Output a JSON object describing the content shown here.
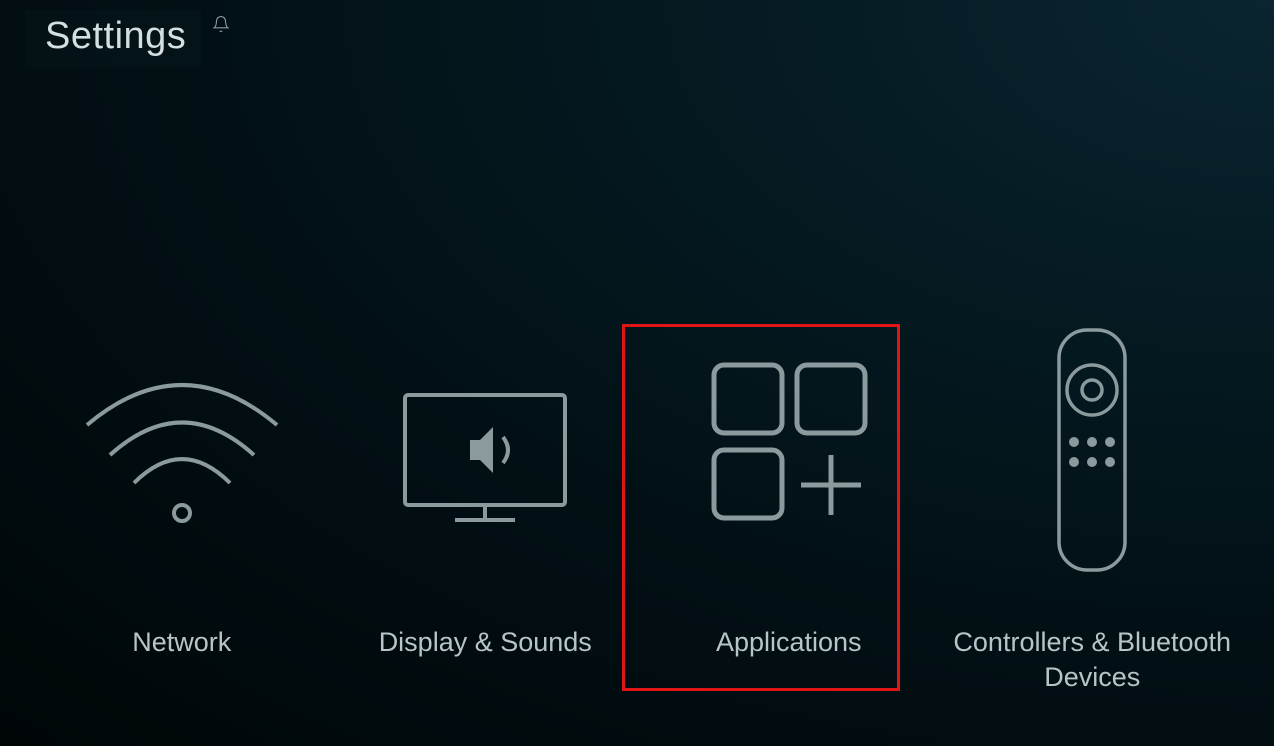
{
  "header": {
    "title": "Settings"
  },
  "tiles": [
    {
      "label": "Network",
      "icon": "wifi-icon"
    },
    {
      "label": "Display & Sounds",
      "icon": "display-sound-icon"
    },
    {
      "label": "Applications",
      "icon": "apps-icon",
      "highlighted": true
    },
    {
      "label": "Controllers & Bluetooth Devices",
      "icon": "remote-icon"
    }
  ],
  "colors": {
    "highlight": "#e11515",
    "foreground": "#b8c5c8",
    "stroke": "#8a9a9d"
  }
}
